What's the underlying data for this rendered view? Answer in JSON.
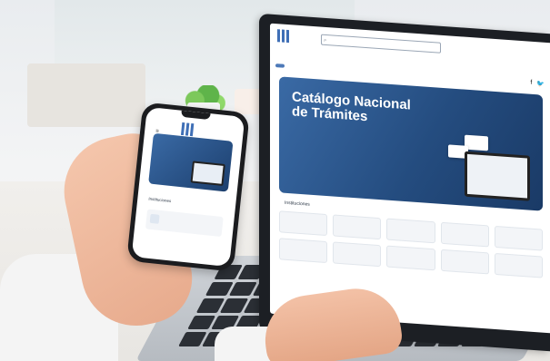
{
  "laptop": {
    "search_placeholder": "",
    "nav": {
      "button_label": "",
      "items": [
        "",
        "",
        "",
        "",
        "",
        ""
      ],
      "social": {
        "facebook_icon": "f",
        "twitter_icon": "twitter"
      }
    },
    "hero": {
      "title": "Catálogo Nacional de Trámites",
      "text": ""
    },
    "section_label": "Instituciones",
    "institutions": [
      "",
      "",
      "",
      "",
      "",
      "",
      "",
      "",
      "",
      ""
    ]
  },
  "phone": {
    "hero_title": "",
    "section_label": "Instituciones",
    "card_text": "",
    "footer": ""
  },
  "colors": {
    "brand_blue": "#3a6aa5",
    "brand_dark": "#1a3a66"
  }
}
